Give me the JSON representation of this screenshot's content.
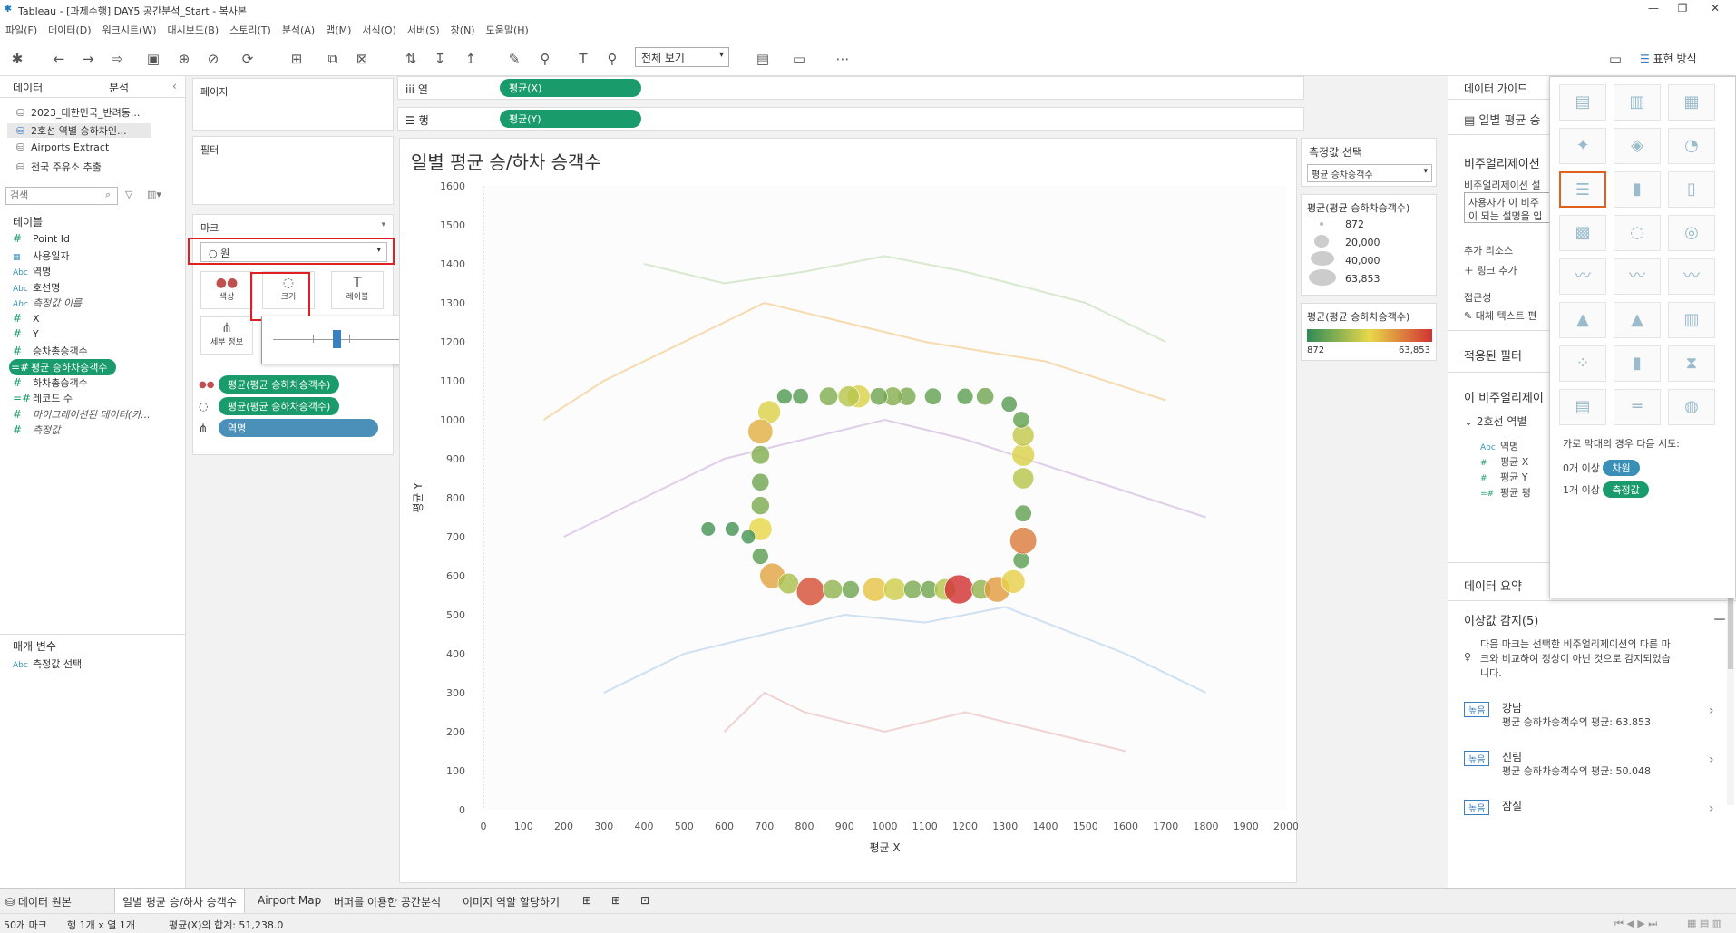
{
  "window": {
    "title": "Tableau - [과제수행] DAY5 공간분석_Start - 복사본"
  },
  "menu": [
    "파일(F)",
    "데이터(D)",
    "워크시트(W)",
    "대시보드(B)",
    "스토리(T)",
    "분석(A)",
    "맵(M)",
    "서식(O)",
    "서버(S)",
    "창(N)",
    "도움말(H)"
  ],
  "toolbar": {
    "view_dropdown": "전체 보기",
    "showme_label": "표현 방식"
  },
  "left": {
    "tab_data": "데이터",
    "tab_analysis": "분석",
    "datasources": [
      "2023_대한민국_반려동...",
      "2호선 역별 승하차인...",
      "Airports Extract",
      "전국 주유소 추출"
    ],
    "search_placeholder": "검색",
    "tables_label": "테이블",
    "fields": [
      {
        "type": "#",
        "name": "Point Id",
        "kind": "m",
        "style": ""
      },
      {
        "type": "▦",
        "name": "사용일자",
        "kind": "d",
        "style": ""
      },
      {
        "type": "Abc",
        "name": "역명",
        "kind": "d",
        "style": ""
      },
      {
        "type": "Abc",
        "name": "호선명",
        "kind": "d",
        "style": ""
      },
      {
        "type": "Abc",
        "name": "측정값 이름",
        "kind": "d",
        "style": "it"
      },
      {
        "type": "#",
        "name": "X",
        "kind": "m",
        "style": ""
      },
      {
        "type": "#",
        "name": "Y",
        "kind": "m",
        "style": ""
      },
      {
        "type": "#",
        "name": "승차총승객수",
        "kind": "m",
        "style": ""
      },
      {
        "type": "=#",
        "name": "평균 승하차승객수",
        "kind": "m",
        "style": "hl"
      },
      {
        "type": "#",
        "name": "하차총승객수",
        "kind": "m",
        "style": ""
      },
      {
        "type": "=#",
        "name": "레코드 수",
        "kind": "m",
        "style": ""
      },
      {
        "type": "#",
        "name": "마이그레이션된 데이터(카...",
        "kind": "m",
        "style": "it"
      },
      {
        "type": "#",
        "name": "측정값",
        "kind": "m",
        "style": "it"
      }
    ],
    "params_label": "매개 변수",
    "params": [
      {
        "type": "Abc",
        "name": "측정값 선택"
      }
    ]
  },
  "cards": {
    "pages": "페이지",
    "filters": "필터",
    "marks": "마크",
    "mark_type": "원",
    "mark_buttons": [
      {
        "label": "색상",
        "icon": "●●"
      },
      {
        "label": "크기",
        "icon": "◌"
      },
      {
        "label": "레이블",
        "icon": "T"
      },
      {
        "label": "세부 정보",
        "icon": "⋔"
      }
    ],
    "mark_fields": [
      {
        "icon": "●●",
        "label": "평균(평균 승하차승객수)",
        "color": "g"
      },
      {
        "icon": "◌",
        "label": "평균(평균 승하차승객수)",
        "color": "g"
      },
      {
        "icon": "⋔",
        "label": "역명",
        "color": "b"
      }
    ]
  },
  "shelves": {
    "columns_label": "열",
    "columns_pill": "평균(X)",
    "rows_label": "행",
    "rows_pill": "평균(Y)"
  },
  "chart_data": {
    "type": "scatter",
    "title": "일별 평균 승/하차 승객수",
    "xlabel": "평균 X",
    "ylabel": "평균 Y",
    "xlim": [
      0,
      2000
    ],
    "ylim": [
      0,
      1600
    ],
    "x_ticks": [
      0,
      100,
      200,
      300,
      400,
      500,
      600,
      700,
      800,
      900,
      1000,
      1100,
      1200,
      1300,
      1400,
      1500,
      1600,
      1700,
      1800,
      1900,
      2000
    ],
    "y_ticks": [
      0,
      100,
      200,
      300,
      400,
      500,
      600,
      700,
      800,
      900,
      1000,
      1100,
      1200,
      1300,
      1400,
      1500,
      1600
    ],
    "color_range": [
      872,
      63853
    ],
    "points": [
      {
        "x": 712,
        "y": 1020,
        "v": 30000
      },
      {
        "x": 690,
        "y": 970,
        "v": 40000
      },
      {
        "x": 690,
        "y": 910,
        "v": 15000
      },
      {
        "x": 690,
        "y": 840,
        "v": 12000
      },
      {
        "x": 690,
        "y": 780,
        "v": 14000
      },
      {
        "x": 690,
        "y": 720,
        "v": 32000
      },
      {
        "x": 690,
        "y": 650,
        "v": 9000
      },
      {
        "x": 720,
        "y": 600,
        "v": 42000
      },
      {
        "x": 760,
        "y": 580,
        "v": 22000
      },
      {
        "x": 815,
        "y": 560,
        "v": 58000
      },
      {
        "x": 870,
        "y": 565,
        "v": 18000
      },
      {
        "x": 915,
        "y": 565,
        "v": 12000
      },
      {
        "x": 975,
        "y": 565,
        "v": 36000
      },
      {
        "x": 1025,
        "y": 565,
        "v": 28000
      },
      {
        "x": 1070,
        "y": 565,
        "v": 14000
      },
      {
        "x": 1110,
        "y": 565,
        "v": 12000
      },
      {
        "x": 1150,
        "y": 565,
        "v": 24000
      },
      {
        "x": 1185,
        "y": 565,
        "v": 63853
      },
      {
        "x": 1240,
        "y": 565,
        "v": 18000
      },
      {
        "x": 1280,
        "y": 565,
        "v": 44000
      },
      {
        "x": 1320,
        "y": 585,
        "v": 34000
      },
      {
        "x": 1340,
        "y": 640,
        "v": 9000
      },
      {
        "x": 1345,
        "y": 690,
        "v": 50048
      },
      {
        "x": 1345,
        "y": 760,
        "v": 10000
      },
      {
        "x": 1345,
        "y": 850,
        "v": 24000
      },
      {
        "x": 1345,
        "y": 910,
        "v": 30000
      },
      {
        "x": 1345,
        "y": 960,
        "v": 26000
      },
      {
        "x": 1340,
        "y": 1000,
        "v": 10000
      },
      {
        "x": 1310,
        "y": 1040,
        "v": 8000
      },
      {
        "x": 1250,
        "y": 1060,
        "v": 12000
      },
      {
        "x": 1200,
        "y": 1060,
        "v": 9000
      },
      {
        "x": 1120,
        "y": 1060,
        "v": 10000
      },
      {
        "x": 1055,
        "y": 1060,
        "v": 14000
      },
      {
        "x": 1020,
        "y": 1060,
        "v": 16000
      },
      {
        "x": 985,
        "y": 1060,
        "v": 12000
      },
      {
        "x": 935,
        "y": 1060,
        "v": 30000
      },
      {
        "x": 910,
        "y": 1060,
        "v": 24000
      },
      {
        "x": 860,
        "y": 1060,
        "v": 15000
      },
      {
        "x": 790,
        "y": 1060,
        "v": 8000
      },
      {
        "x": 750,
        "y": 1060,
        "v": 7000
      },
      {
        "x": 620,
        "y": 720,
        "v": 5000
      },
      {
        "x": 560,
        "y": 720,
        "v": 5000
      },
      {
        "x": 660,
        "y": 700,
        "v": 5000
      }
    ]
  },
  "legends": {
    "param_title": "측정값 선택",
    "param_value": "평균 승차승객수",
    "size_title": "평균(평균 승하차승객수)",
    "size_items": [
      "872",
      "20,000",
      "40,000",
      "63,853"
    ],
    "color_title": "평균(평균 승하차승객수)",
    "color_min": "872",
    "color_max": "63,853",
    "colors": {
      "low": "#2e8b57",
      "mid": "#e8d84a",
      "high": "#d13232"
    }
  },
  "right": {
    "guide_title": "데이터 가이드",
    "viz_name": "일별 평균 승",
    "viz_section": "비주얼리제이션",
    "viz_desc_label": "비주얼리제이션 설",
    "viz_desc_box_1": "사용자가 이 비주",
    "viz_desc_box_2": "이 되는 설명을 입",
    "resources": "추가 리소스",
    "add_link": "링크 추가",
    "access": "접근성",
    "alt_text": "대체 텍스트 편",
    "applied_filters": "적용된 필터",
    "this_viz": "이 비주얼리제이",
    "source": "2호선 역별",
    "source_fields": [
      {
        "type": "Abc",
        "name": "역명"
      },
      {
        "type": "#",
        "name": "평균 X"
      },
      {
        "type": "#",
        "name": "평균 Y"
      },
      {
        "type": "=#",
        "name": "평균 평"
      }
    ],
    "summary": "데이터 요약",
    "outliers_title": "이상값 감지(5)",
    "outliers_desc_1": "다음 마크는 선택한 비주얼리제이션의 다른 마",
    "outliers_desc_2": "크와 비교하여 정상이 아닌 것으로 감지되었습",
    "outliers_desc_3": "니다.",
    "outliers": [
      {
        "tag": "높음",
        "name": "강남",
        "desc": "평균 승하차승객수의 평균: 63.853"
      },
      {
        "tag": "높음",
        "name": "신림",
        "desc": "평균 승하차승객수의 평균: 50.048"
      },
      {
        "tag": "높음",
        "name": "잠실",
        "desc": ""
      }
    ]
  },
  "showme": {
    "hint": "가로 막대의 경우 다음 시도:",
    "req1_prefix": "0개 이상",
    "req1_badge": "차원",
    "req2_prefix": "1개 이상",
    "req2_badge": "측정값"
  },
  "bottom_tabs": [
    "데이터 원본",
    "일별 평균 승/하차 승객수",
    "Airport Map",
    "버퍼를 이용한 공간분석",
    "이미지 역할 할당하기"
  ],
  "status": {
    "marks": "50개 마크",
    "rows_cols": "행 1개 x 열 1개",
    "sum": "평균(X)의 합계: 51,238.0"
  }
}
